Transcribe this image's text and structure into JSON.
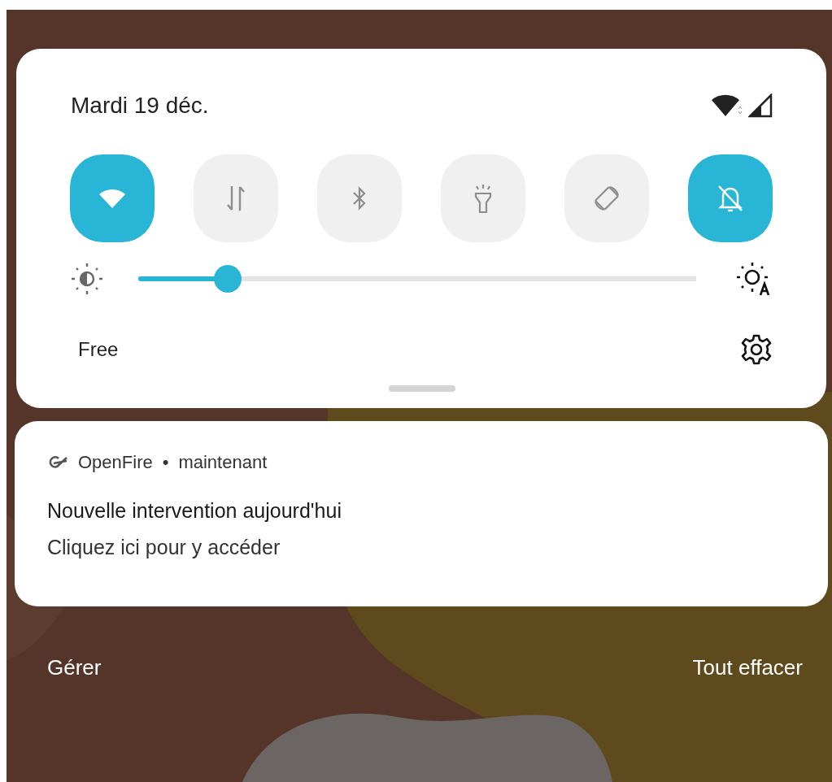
{
  "quick_settings": {
    "date": "Mardi 19 déc.",
    "tiles": [
      {
        "kind": "wifi",
        "on": true
      },
      {
        "kind": "data",
        "on": false
      },
      {
        "kind": "bluetooth",
        "on": false
      },
      {
        "kind": "flashlight",
        "on": false
      },
      {
        "kind": "rotate",
        "on": false
      },
      {
        "kind": "mute",
        "on": true
      }
    ],
    "brightness": {
      "level": 0.16
    },
    "carrier": "Free"
  },
  "notification": {
    "app": "OpenFire",
    "separator": "•",
    "time": "maintenant",
    "title": "Nouvelle intervention aujourd'hui",
    "body": "Cliquez ici pour y accéder"
  },
  "actions": [
    "Gérer",
    "Tout effacer"
  ]
}
